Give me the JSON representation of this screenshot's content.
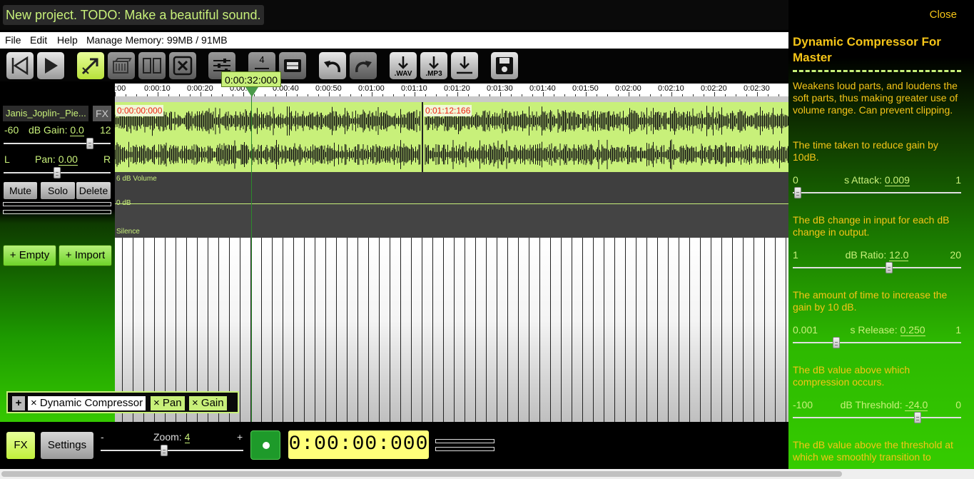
{
  "project": {
    "title": "New project. TODO: Make a beautiful sound."
  },
  "menu": {
    "file": "File",
    "edit": "Edit",
    "help": "Help",
    "memory": "Manage Memory: 99MB / 91MB"
  },
  "toolbar": {
    "pitch_number": "4",
    "wav_label": ".WAV",
    "mp3_label": ".MP3"
  },
  "playhead": {
    "time": "0:00:32:000"
  },
  "ruler": {
    "ticks": [
      ":00",
      "0:00:10",
      "0:00:20",
      "0:00:30",
      "0:00:40",
      "0:00:50",
      "0:01:00",
      "0:01:10",
      "0:01:20",
      "0:01:30",
      "0:01:40",
      "0:01:50",
      "0:02:00",
      "0:02:10",
      "0:02:20",
      "0:02:30"
    ]
  },
  "track": {
    "name": "Janis_Joplin-_Pie...",
    "fx_label": "FX",
    "gain": {
      "min": "-60",
      "label": "dB Gain:",
      "value": "0.0",
      "max": "12"
    },
    "pan": {
      "left": "L",
      "label": "Pan:",
      "value": "0.00",
      "right": "R"
    },
    "mute": "Mute",
    "solo": "Solo",
    "delete": "Delete"
  },
  "clips": {
    "start_time": "0:00:00:000",
    "split_time": "0:01:12:166"
  },
  "automation": {
    "top_label": "6 dB Volume",
    "mid_label": "0 dB",
    "bottom_label": "Silence"
  },
  "add_buttons": {
    "empty": "+ Empty",
    "import": "+ Import"
  },
  "effects_chain": {
    "add": "+",
    "items": [
      "× Dynamic Compressor",
      "× Pan",
      "× Gain"
    ]
  },
  "bottom": {
    "fx": "FX",
    "settings": "Settings",
    "zoom_minus": "-",
    "zoom_label": "Zoom:",
    "zoom_value": "4",
    "zoom_plus": "+",
    "time": "0:00:00:000"
  },
  "panel": {
    "close": "Close",
    "title": "Dynamic Compressor For Master",
    "intro": "Weakens loud parts, and loudens the soft parts, thus making greater use of volume range. Can prevent clipping.",
    "params": [
      {
        "desc": "The time taken to reduce gain by 10dB.",
        "min": "0",
        "label": "s Attack:",
        "value": "0.009",
        "max": "1"
      },
      {
        "desc": "The dB change in input for each dB change in output.",
        "min": "1",
        "label": "dB Ratio:",
        "value": "12.0",
        "max": "20"
      },
      {
        "desc": "The amount of time to increase the gain by 10 dB.",
        "min": "0.001",
        "label": "s Release:",
        "value": "0.250",
        "max": "1"
      },
      {
        "desc": "The dB value above which compression occurs.",
        "min": "-100",
        "label": "dB Threshold:",
        "value": "-24.0",
        "max": "0"
      }
    ],
    "knee_desc": "The dB value above the threshold at which we smoothly transition to"
  },
  "colors": {
    "accent": "#c8f07a",
    "panel_text": "#f5c518",
    "clip_time": "#ee2211",
    "record": "#1e9a2a"
  },
  "icons": [
    "skip-back-icon",
    "play-icon",
    "select-tool-icon",
    "copy-icon",
    "split-icon",
    "delete-icon",
    "mixer-icon",
    "tempo-icon",
    "filmstrip-icon",
    "undo-icon",
    "redo-icon",
    "download-wav-icon",
    "download-mp3-icon",
    "download-icon",
    "save-icon"
  ]
}
